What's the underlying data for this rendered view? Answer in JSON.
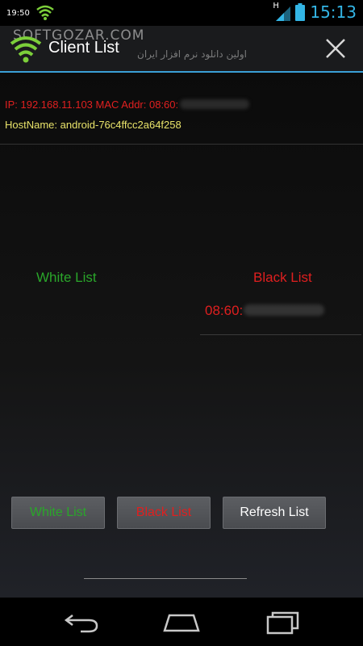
{
  "status_bar": {
    "notification_time": "19:50",
    "network_label": "H",
    "clock": "15:13"
  },
  "watermark": {
    "text": "SOFTGOZAR.COM",
    "subtext": "اولین دانلود نرم افزار ایران"
  },
  "action_bar": {
    "title": "Client List"
  },
  "client_info": {
    "ip_text": "IP: 192.168.11.103 MAC Addr: 08:60:",
    "hostname_text": "HostName: android-76c4ffcc2a64f258"
  },
  "lists": {
    "white_heading": "White List",
    "black_heading": "Black List",
    "black_items": [
      "08:60:"
    ]
  },
  "buttons": {
    "white_label": "White List",
    "black_label": "Black List",
    "refresh_label": "Refresh List"
  },
  "colors": {
    "accent_blue": "#33b5e5",
    "white_list_green": "#2aa62a",
    "black_list_red": "#e01f1f",
    "hostname_yellow": "#e9e36a"
  }
}
